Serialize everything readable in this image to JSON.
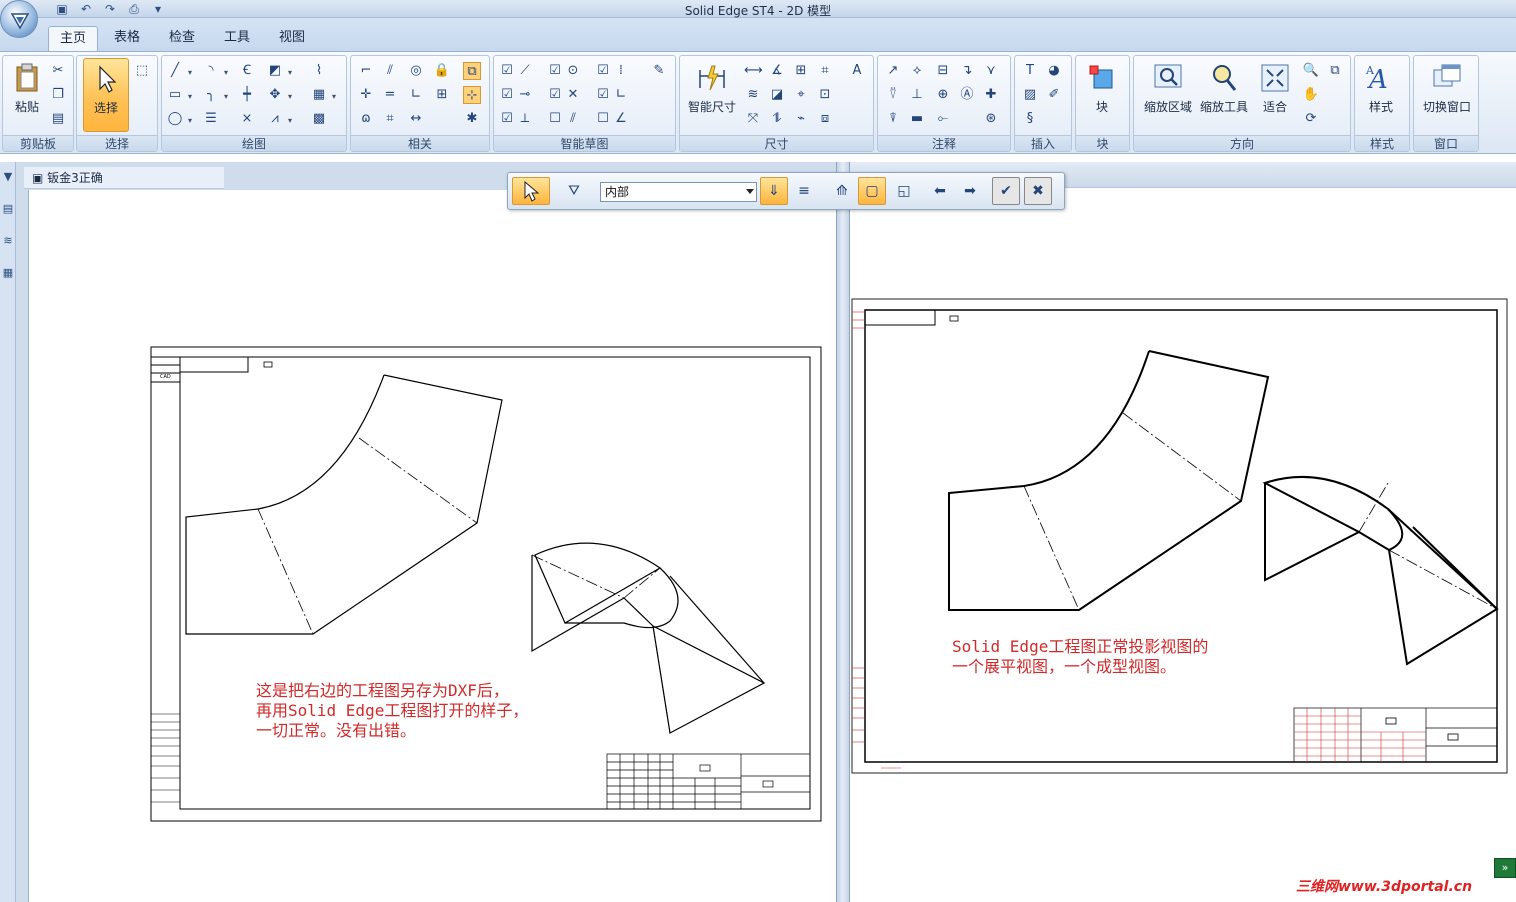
{
  "window": {
    "title": "Solid Edge ST4 - 2D 模型"
  },
  "tabs": [
    "主页",
    "表格",
    "检查",
    "工具",
    "视图"
  ],
  "ribbon": {
    "groups": {
      "clipboard": "剪贴板",
      "select": "选择",
      "draw": "绘图",
      "relate": "相关",
      "intellisketch": "智能草图",
      "dimension": "尺寸",
      "annotation": "注释",
      "insert": "插入",
      "block": "块",
      "orient": "方向",
      "style": "样式",
      "window": "窗口"
    },
    "buttons": {
      "paste": "粘贴",
      "select": "选择",
      "smart_dimension": "智能尺寸",
      "block": "块",
      "zoom_area": "缩放区域",
      "zoom_tool": "缩放工具",
      "fit": "适合",
      "styles": "样式",
      "switch_window": "切换窗口"
    }
  },
  "document": {
    "tab_title": "钣金3正确"
  },
  "command_bar": {
    "select_value": "内部"
  },
  "annotations": {
    "left": "这是把右边的工程图另存为DXF后，\n再用Solid Edge工程图打开的样子，\n一切正常。没有出错。",
    "right": "Solid Edge工程图正常投影视图的\n一个展平视图，一个成型视图。"
  },
  "title_block": {
    "cad_label": "CAD"
  },
  "watermark": "三维网www.3dportal.cn"
}
